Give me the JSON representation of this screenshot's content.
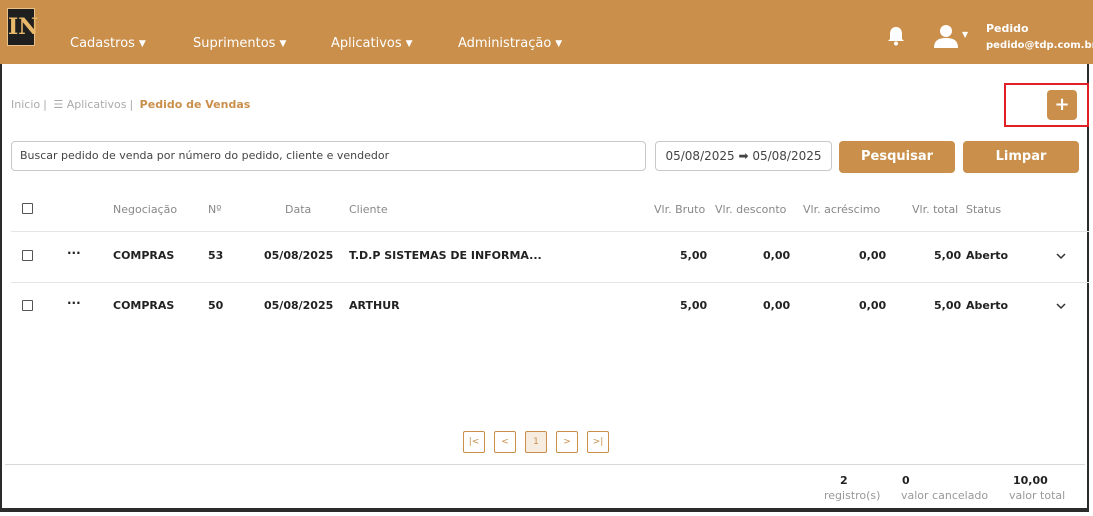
{
  "logo": {
    "text": "IN"
  },
  "nav": {
    "items": [
      {
        "label": "Cadastros"
      },
      {
        "label": "Suprimentos"
      },
      {
        "label": "Aplicativos"
      },
      {
        "label": "Administração"
      }
    ],
    "user_name": "Pedido",
    "user_email": "pedido@tdp.com.br"
  },
  "breadcrumb": {
    "home": "Inicio",
    "apps": "Aplicativos",
    "current": "Pedido de Vendas"
  },
  "add_button": {
    "label": "+"
  },
  "search": {
    "placeholder": "Buscar pedido de venda por número do pedido, cliente e vendedor",
    "date_range": "05/08/2025 ➡ 05/08/2025",
    "search_label": "Pesquisar",
    "clear_label": "Limpar"
  },
  "table": {
    "headers": {
      "negociacao": "Negociação",
      "numero": "Nº",
      "data": "Data",
      "cliente": "Cliente",
      "bruto": "Vlr. Bruto",
      "desconto": "Vlr. desconto",
      "acrescimo": "Vlr. acréscimo",
      "total": "Vlr. total",
      "status": "Status"
    },
    "rows": [
      {
        "negociacao": "COMPRAS",
        "numero": "53",
        "data": "05/08/2025",
        "cliente": "T.D.P SISTEMAS DE INFORMA...",
        "bruto": "5,00",
        "desconto": "0,00",
        "acrescimo": "0,00",
        "total": "5,00",
        "status": "Aberto"
      },
      {
        "negociacao": "COMPRAS",
        "numero": "50",
        "data": "05/08/2025",
        "cliente": "ARTHUR",
        "bruto": "5,00",
        "desconto": "0,00",
        "acrescimo": "0,00",
        "total": "5,00",
        "status": "Aberto"
      }
    ]
  },
  "pager": {
    "first": "|<",
    "prev": "<",
    "page": "1",
    "next": ">",
    "last": ">|"
  },
  "summary": {
    "registros": "2",
    "registros_label": "registro(s)",
    "cancelado": "0",
    "cancelado_label": "valor cancelado",
    "total": "10,00",
    "total_label": "valor total"
  },
  "colors": {
    "accent": "#c98f4b",
    "highlight": "#e01f26"
  },
  "icons": [
    "bell-icon",
    "user-icon",
    "chevron-down-icon",
    "checkbox-icon",
    "more-icon"
  ]
}
